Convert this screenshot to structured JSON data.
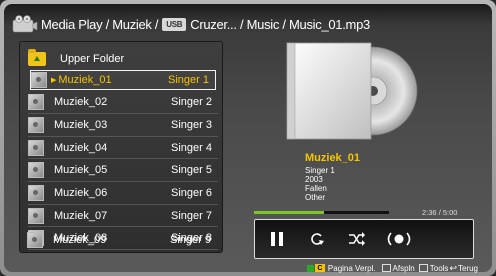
{
  "breadcrumb": {
    "part1": "Media Play / Muziek /",
    "usb_label": "USB",
    "part2": "Cruzer... / Music / Music_01.mp3"
  },
  "file_list": {
    "upper_folder_label": "Upper Folder",
    "selected_index": 0,
    "items": [
      {
        "name": "Muziek_01",
        "singer": "Singer 1"
      },
      {
        "name": "Muziek_02",
        "singer": "Singer 2"
      },
      {
        "name": "Muziek_03",
        "singer": "Singer 3"
      },
      {
        "name": "Muziek_04",
        "singer": "Singer 4"
      },
      {
        "name": "Muziek_05",
        "singer": "Singer 5"
      },
      {
        "name": "Muziek_06",
        "singer": "Singer 6"
      },
      {
        "name": "Muziek_07",
        "singer": "Singer 7"
      },
      {
        "name": "Muziek_08",
        "singer": "Singer 8"
      },
      {
        "name": "Muziek_09",
        "singer": "Singer 9"
      }
    ]
  },
  "now_playing": {
    "title": "Muziek_01",
    "singer": "Singer 1",
    "year": "2003",
    "album": "Fallen",
    "genre": "Other",
    "elapsed": "2:36",
    "total": "5:00",
    "time_separator": " / ",
    "progress_fraction": 0.52
  },
  "controls": [
    {
      "icon": "pause-icon",
      "glyph": "❚❚"
    },
    {
      "icon": "repeat-icon",
      "glyph": "↻"
    },
    {
      "icon": "shuffle-icon",
      "glyph": "⤨"
    },
    {
      "icon": "sound-mode-icon",
      "glyph": "(●)"
    }
  ],
  "footer": {
    "c_key": "C",
    "c_label": "Pagina Verpl.",
    "play_label": "Afspln",
    "tools_label": "Tools",
    "return_label": "Terug"
  },
  "colors": {
    "accent": "#f5c400",
    "progress": "#7cc62a"
  }
}
